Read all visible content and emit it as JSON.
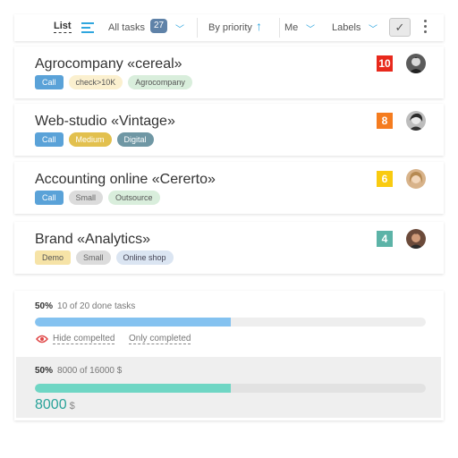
{
  "toolbar": {
    "list_label": "List",
    "all_tasks_label": "All tasks",
    "task_count": "27",
    "priority_label": "By priority",
    "priority_arrow": "↑",
    "me_label": "Me",
    "labels_label": "Labels",
    "chevron": "﹀",
    "check_glyph": "✓"
  },
  "tasks": [
    {
      "title": "Agrocompany «cereal»",
      "priority": "10",
      "priority_color": "#e8291c",
      "tags": [
        "Call",
        "check>10K",
        "Agrocompany"
      ]
    },
    {
      "title": "Web-studio «Vintage»",
      "priority": "8",
      "priority_color": "#f57c1f",
      "tags": [
        "Call",
        "Medium",
        "Digital"
      ]
    },
    {
      "title": "Accounting online «Cererto»",
      "priority": "6",
      "priority_color": "#f9cb10",
      "tags": [
        "Call",
        "Small",
        "Outsource"
      ]
    },
    {
      "title": "Brand «Analytics»",
      "priority": "4",
      "priority_color": "#5cb3a7",
      "tags": [
        "Demo",
        "Small",
        "Online shop"
      ]
    }
  ],
  "summary": {
    "tasks_percent": "50%",
    "tasks_text": "10 of 20 done tasks",
    "tasks_progress": 0.5,
    "hide_completed": "Hide compelted",
    "only_completed": "Only completed",
    "money_percent": "50%",
    "money_text": "8000  of 16000 $",
    "money_progress": 0.5,
    "money_value": "8000",
    "money_currency": "$"
  },
  "colors": {
    "accent": "#2fa6de",
    "tasks_bar": "#84c2f0",
    "money_bar": "#6fd6c4"
  }
}
